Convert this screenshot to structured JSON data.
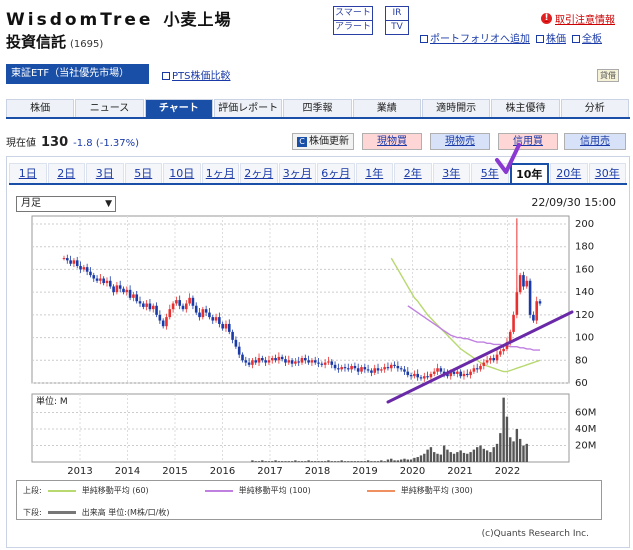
{
  "header": {
    "name": "WisdomTree",
    "name_jp": "小麦上場",
    "subtitle": "投資信託",
    "code": "(1695)",
    "alert_top": "スマート",
    "alert_bottom": "アラート",
    "ir_top": "IR",
    "ir_bottom": "TV",
    "warning": "取引注意情報",
    "warning_icon": "!",
    "link_portfolio": "ポートフォリオへ追加",
    "link_stock": "株価",
    "link_all": "全板"
  },
  "market": {
    "label": "東証ETF（当社優先市場）",
    "pts": "PTS株価比較",
    "tag": "貸借"
  },
  "tabs": [
    "株価",
    "ニュース",
    "チャート",
    "評価レポート",
    "四季報",
    "業績",
    "適時開示",
    "株主優待",
    "分析"
  ],
  "active_tab": 2,
  "price": {
    "label": "現在値",
    "value": "130",
    "change": "-1.8 (-1.37%)"
  },
  "buttons": {
    "update": "株価更新",
    "update_icon": "C",
    "spot_buy": "現物買",
    "spot_sell": "現物売",
    "margin_buy": "信用買",
    "margin_sell": "信用売"
  },
  "periods": [
    "1日",
    "2日",
    "3日",
    "5日",
    "10日",
    "1ヶ月",
    "2ヶ月",
    "3ヶ月",
    "6ヶ月",
    "1年",
    "2年",
    "3年",
    "5年",
    "10年",
    "20年",
    "30年"
  ],
  "active_period": 13,
  "chart": {
    "timeframe": "月足",
    "date": "22/09/30 15:00",
    "volume_unit": "単位: M",
    "legend_upper": "上段:",
    "legend_lower": "下段:",
    "ma60_label": "単純移動平均 (60)",
    "ma100_label": "単純移動平均 (100)",
    "ma300_label": "単純移動平均 (300)",
    "volume_label": "出来高 単位:(M株/口/枚)",
    "copyright": "(c)Quants Research Inc.",
    "colors": {
      "up": "#e83030",
      "down": "#1a3aa8",
      "ma60": "#b8d870",
      "ma100": "#c080e0",
      "ma300": "#f09060",
      "trend": "#6a2aa8",
      "check": "#8a3ad0"
    }
  },
  "chart_data": {
    "type": "candlestick",
    "x_ticks": [
      "2013",
      "2014",
      "2015",
      "2016",
      "2017",
      "2018",
      "2019",
      "2020",
      "2021",
      "2022"
    ],
    "price_ylim": [
      60,
      200
    ],
    "price_ticks": [
      200,
      180,
      160,
      140,
      120,
      100,
      80,
      60
    ],
    "volume_ticks": [
      "60M",
      "40M",
      "20M"
    ],
    "volume_ylim": [
      0,
      80
    ],
    "closes": [
      170,
      168,
      165,
      168,
      163,
      160,
      162,
      158,
      155,
      152,
      150,
      152,
      148,
      150,
      145,
      140,
      146,
      143,
      140,
      142,
      135,
      138,
      132,
      130,
      127,
      130,
      125,
      128,
      120,
      115,
      110,
      118,
      125,
      130,
      133,
      128,
      125,
      130,
      135,
      128,
      122,
      118,
      125,
      122,
      118,
      115,
      118,
      112,
      108,
      112,
      105,
      98,
      92,
      85,
      80,
      78,
      76,
      80,
      78,
      82,
      80,
      78,
      80,
      82,
      80,
      83,
      81,
      78,
      80,
      77,
      79,
      78,
      82,
      80,
      78,
      80,
      78,
      77,
      76,
      78,
      79,
      76,
      73,
      72,
      74,
      73,
      72,
      75,
      73,
      70,
      74,
      72,
      71,
      69,
      73,
      71,
      72,
      74,
      73,
      76,
      75,
      73,
      72,
      70,
      67,
      66,
      68,
      65,
      64,
      66,
      65,
      68,
      70,
      73,
      70,
      68,
      66,
      70,
      68,
      70,
      66,
      68,
      67,
      70,
      73,
      72,
      75,
      78,
      80,
      82,
      80,
      85,
      88,
      90,
      96,
      105,
      120,
      140,
      155,
      145,
      150,
      120,
      115,
      132,
      130
    ],
    "ma60": [
      null,
      null,
      null,
      null,
      null,
      null,
      null,
      null,
      null,
      null,
      null,
      null,
      null,
      null,
      null,
      null,
      null,
      null,
      null,
      null,
      null,
      null,
      null,
      null,
      null,
      null,
      null,
      null,
      null,
      null,
      null,
      null,
      null,
      null,
      null,
      null,
      null,
      null,
      null,
      null,
      null,
      null,
      null,
      170,
      165,
      160,
      155,
      150,
      145,
      140,
      135,
      132,
      128,
      124,
      120,
      117,
      114,
      111,
      108,
      105,
      102,
      99,
      96,
      93,
      90,
      88,
      86,
      84,
      82,
      80,
      78,
      76,
      75,
      74,
      73,
      72,
      71,
      70,
      70,
      71,
      72,
      73,
      74,
      75,
      76,
      77,
      78,
      79,
      80
    ],
    "ma100": [
      null,
      null,
      null,
      null,
      null,
      null,
      null,
      null,
      null,
      null,
      null,
      null,
      null,
      null,
      null,
      null,
      null,
      null,
      null,
      null,
      null,
      null,
      null,
      null,
      null,
      null,
      null,
      null,
      null,
      null,
      null,
      null,
      null,
      null,
      null,
      null,
      null,
      null,
      null,
      null,
      null,
      null,
      null,
      null,
      null,
      null,
      null,
      null,
      null,
      null,
      null,
      null,
      null,
      null,
      null,
      null,
      null,
      null,
      null,
      null,
      null,
      null,
      null,
      null,
      null,
      null,
      128,
      126,
      124,
      122,
      120,
      118,
      116,
      114,
      112,
      110,
      108,
      106,
      104,
      102,
      101,
      100,
      100,
      99,
      99,
      98,
      97,
      96,
      96,
      96,
      95,
      95,
      94,
      94,
      94,
      93,
      93,
      92,
      92,
      92,
      91,
      91,
      90,
      90,
      89,
      89,
      89
    ],
    "volume": [
      0,
      0,
      0,
      0,
      0,
      0,
      0,
      0,
      0,
      0,
      0,
      0,
      0,
      0,
      0,
      0,
      0,
      0,
      0,
      0,
      0,
      0,
      0,
      0,
      0,
      0,
      0,
      0,
      0,
      0,
      0,
      0,
      0,
      0,
      0,
      0,
      0,
      0,
      0,
      0,
      0,
      0,
      0,
      0,
      0,
      0,
      0,
      0,
      0,
      0,
      0,
      0,
      0,
      0,
      0,
      0,
      0,
      2,
      1,
      1,
      2,
      1,
      1,
      1,
      2,
      1,
      1,
      1,
      1,
      1,
      2,
      1,
      1,
      1,
      2,
      1,
      1,
      1,
      1,
      1,
      2,
      1,
      1,
      1,
      2,
      1,
      1,
      1,
      1,
      1,
      1,
      1,
      2,
      1,
      1,
      1,
      2,
      1,
      3,
      4,
      2,
      2,
      3,
      4,
      3,
      3,
      5,
      6,
      8,
      10,
      15,
      18,
      12,
      10,
      9,
      20,
      15,
      12,
      10,
      12,
      14,
      11,
      10,
      12,
      15,
      18,
      20,
      16,
      14,
      12,
      18,
      22,
      35,
      78,
      55,
      30,
      25,
      40,
      28,
      20,
      22
    ]
  }
}
